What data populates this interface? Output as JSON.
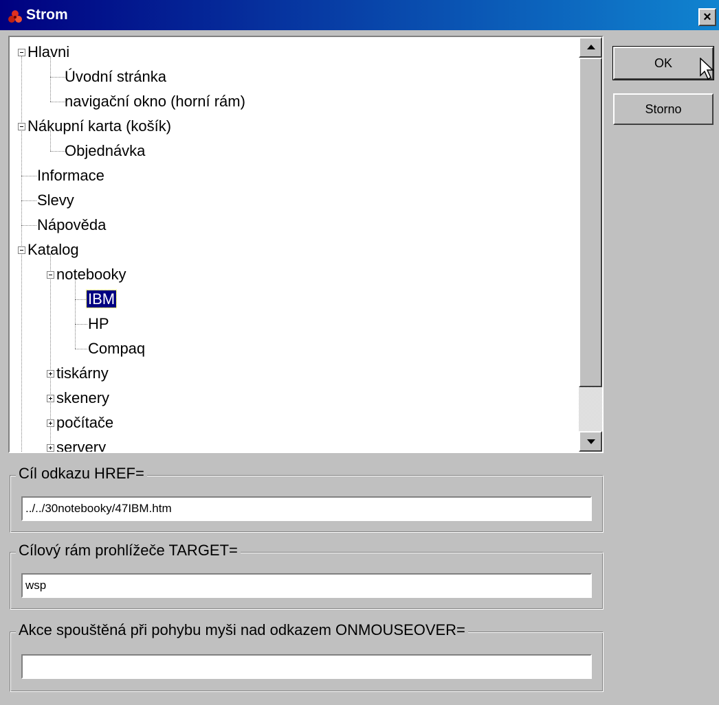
{
  "window": {
    "title": "Strom",
    "close_label": "×"
  },
  "tree": {
    "nodes": [
      {
        "label": "Hlavni",
        "expander": "minus"
      },
      {
        "label": "Úvodní stránka"
      },
      {
        "label": "navigační okno (horní rám)"
      },
      {
        "label": "Nákupní karta (košík)",
        "expander": "minus"
      },
      {
        "label": "Objednávka"
      },
      {
        "label": "Informace"
      },
      {
        "label": "Slevy"
      },
      {
        "label": "Nápověda"
      },
      {
        "label": "Katalog",
        "expander": "minus"
      },
      {
        "label": "notebooky",
        "expander": "minus"
      },
      {
        "label": "IBM",
        "selected": true
      },
      {
        "label": "HP"
      },
      {
        "label": "Compaq"
      },
      {
        "label": "tiskárny",
        "expander": "plus"
      },
      {
        "label": "skenery",
        "expander": "plus"
      },
      {
        "label": "počítače",
        "expander": "plus"
      },
      {
        "label": "servery",
        "expander": "plus"
      }
    ]
  },
  "buttons": {
    "ok_label": "OK",
    "cancel_label": "Storno"
  },
  "href_group": {
    "legend": "Cíl odkazu  HREF=",
    "value": "../../30notebooky/47IBM.htm"
  },
  "target_group": {
    "legend": "Cílový rám prohlížeče  TARGET=",
    "value": "wsp"
  },
  "onmouseover_group": {
    "legend": "Akce spouštěná při pohybu myši nad odkazem  ONMOUSEOVER=",
    "value": ""
  },
  "icons": {
    "app": "app-icon",
    "close": "close-icon",
    "scroll_up": "arrow-up-icon",
    "scroll_down": "arrow-down-icon",
    "cursor": "mouse-pointer-icon"
  },
  "colors": {
    "title_start": "#000080",
    "title_end": "#1084d0",
    "selection": "#000080",
    "face": "#c0c0c0"
  }
}
